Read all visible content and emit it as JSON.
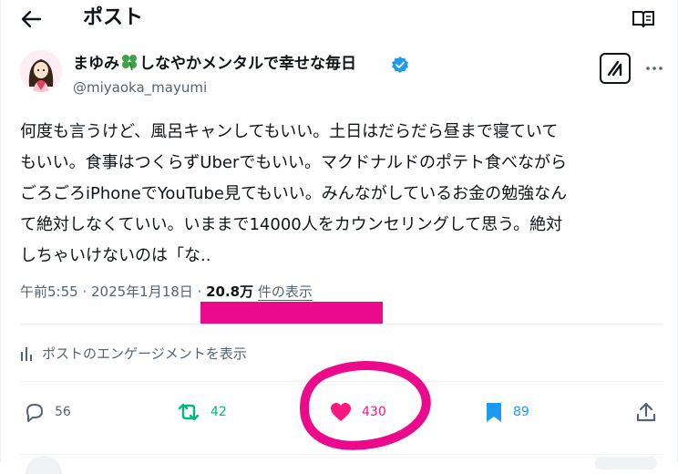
{
  "header": {
    "title": "ポスト",
    "back_icon": "arrow-left-icon",
    "reader_icon": "reader-mode-icon"
  },
  "author": {
    "name": "まゆみ🍀しなやかメンタルで幸せな毎日",
    "name_text": "まゆみ",
    "name_rest": "しなやかメンタルで幸せな毎日",
    "handle": "@miyaoka_mayumi",
    "verified": true,
    "grok_icon": "grok-icon",
    "more_icon": "more-icon"
  },
  "post": {
    "text": "何度も言うけど、風呂キャンしてもいい。土日はだらだら昼まで寝ていて\nもいい。食事はつくらずUberでもいい。マクドナルドのポテト食べながら\nごろごろiPhoneでYouTube見てもいい。みんながしているお金の勉強なん\nて絶対しなくていい。いままで14000人をカウンセリングして思う。絶対\nしちゃいけないのは「な.."
  },
  "meta": {
    "time_date": "午前5:55 · 2025年1月18日 · ",
    "views_count": "20.8万",
    "views_label": "件の表示"
  },
  "engagement": {
    "label": "ポストのエンゲージメントを表示"
  },
  "actions": {
    "reply_count": "56",
    "retweet_count": "42",
    "like_count": "430",
    "bookmark_count": "89",
    "liked": true,
    "bookmarked": true
  },
  "colors": {
    "accent_blue": "#1d9bf0",
    "like_pink": "#f91880",
    "retweet_green": "#00ba7c",
    "annotation_magenta": "#ec0a8c",
    "muted_text": "#536471"
  }
}
